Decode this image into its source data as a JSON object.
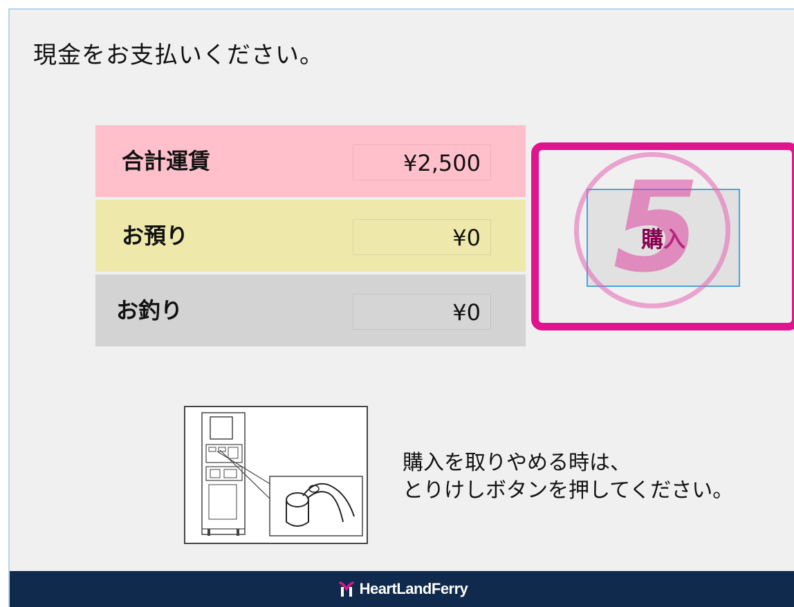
{
  "instruction": "現金をお支払いください。",
  "fare": {
    "total_label": "合計運賃",
    "total_value": "¥2,500",
    "deposit_label": "お預り",
    "deposit_value": "¥0",
    "change_label": "お釣り",
    "change_value": "¥0"
  },
  "buy_button": {
    "label": "購入"
  },
  "step_number": "5",
  "cancel_note": {
    "line1": "購入を取りやめる時は、",
    "line2": "とりけしボタンを押してください。"
  },
  "footer": {
    "brand": "HeartLandFerry",
    "logo_icon": "heartland-logo-icon",
    "background": "#0f2a4c"
  },
  "colors": {
    "total_row": "#ffc0cb",
    "deposit_row": "#eee8aa",
    "change_row": "#d3d3d3",
    "highlight": "#e0148c"
  }
}
